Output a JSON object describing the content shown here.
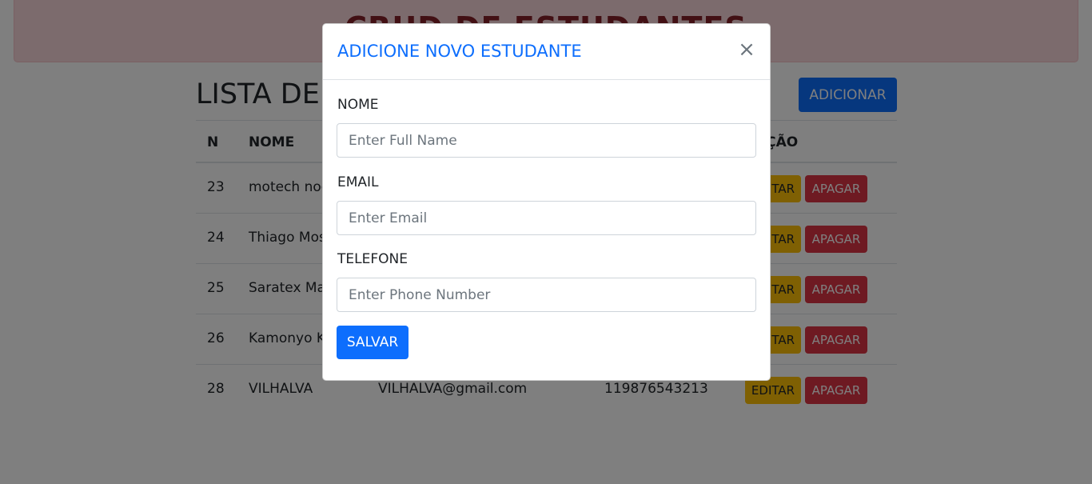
{
  "banner": {
    "title": "CRUD DE ESTUDANTES"
  },
  "page": {
    "list_title": "LISTA DE ESTUDANTES",
    "add_button": "ADICIONAR"
  },
  "table": {
    "headers": {
      "n": "N",
      "nome": "NOME",
      "acao": "AÇÃO"
    },
    "edit_label": "EDITAR",
    "delete_label": "APAGAR",
    "rows": [
      {
        "n": "23",
        "nome": "motech noe",
        "email": "",
        "telefone": ""
      },
      {
        "n": "24",
        "nome": "Thiago Mos",
        "email": "",
        "telefone": ""
      },
      {
        "n": "25",
        "nome": "Saratex Mar",
        "email": "",
        "telefone": ""
      },
      {
        "n": "26",
        "nome": "Kamonyo K",
        "email": "",
        "telefone": ""
      },
      {
        "n": "28",
        "nome": "VILHALVA",
        "email": "VILHALVA@gmail.com",
        "telefone": "119876543213"
      }
    ]
  },
  "modal": {
    "title": "ADICIONE NOVO ESTUDANTE",
    "close": "×",
    "fields": {
      "nome_label": "NOME",
      "nome_placeholder": "Enter Full Name",
      "email_label": "EMAIL",
      "email_placeholder": "Enter Email",
      "telefone_label": "TELEFONE",
      "telefone_placeholder": "Enter Phone Number"
    },
    "save_button": "SALVAR"
  },
  "colors": {
    "primary": "#0d6efd",
    "danger": "#dc3545",
    "warning": "#ffc107",
    "banner_bg": "#f8d7da"
  }
}
